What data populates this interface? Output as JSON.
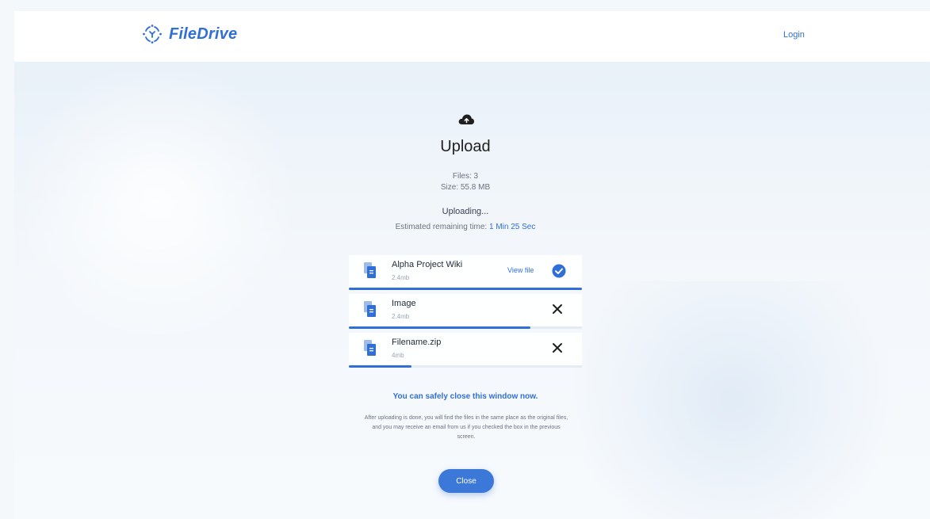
{
  "app": {
    "brand": "FileDrive",
    "login_label": "Login",
    "accent_color": "#2f6fd6"
  },
  "upload": {
    "title": "Upload",
    "files_count": "Files: 3",
    "total_size": "Size: 55.8 MB",
    "status": "Uploading...",
    "eta_label": "Estimated remaining time:",
    "eta_value": "1 Min 25 Sec",
    "files": [
      {
        "name": "Alpha Project Wiki",
        "size": "2.4mb",
        "progress": 1.0,
        "state": "done",
        "action_label": "View file",
        "icon": "file-stack-icon"
      },
      {
        "name": "Image",
        "size": "2.4mb",
        "progress": 0.78,
        "state": "uploading",
        "icon": "file-stack-icon"
      },
      {
        "name": "Filename.zip",
        "size": "4mb",
        "progress": 0.27,
        "state": "uploading",
        "icon": "file-stack-icon"
      }
    ],
    "safe_close_text": "You can safely close this window now.",
    "note": "After uploading is done, you will find the files in the same place as the original files, and you may receive an email from us if you checked the box in the previous screen.",
    "close_label": "Close"
  }
}
